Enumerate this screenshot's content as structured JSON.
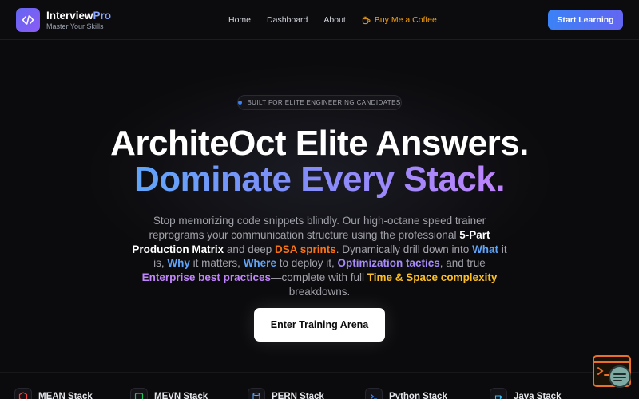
{
  "brand": {
    "name_main": "Interview",
    "name_accent": "Pro",
    "tagline": "Master Your Skills",
    "logo_icon": "code-icon"
  },
  "nav": {
    "links": [
      "Home",
      "Dashboard",
      "About"
    ],
    "coffee_label": "Buy Me a Coffee",
    "coffee_icon": "coffee-cup-icon",
    "cta_label": "Start Learning"
  },
  "hero": {
    "badge": "BUILT FOR ELITE ENGINEERING CANDIDATES",
    "title_line1": "ArchiteOct Elite Answers.",
    "title_line2": "Dominate Every Stack.",
    "desc": {
      "p1": "Stop memorizing code snippets blindly. Our high-octane speed trainer reprograms your communication structure using the professional ",
      "h1": "5-Part Production Matrix",
      "p2": " and deep ",
      "h2": "DSA sprints",
      "p3": ". Dynamically drill down into ",
      "h3": "What",
      "p4": " it is, ",
      "h4": "Why",
      "p5": " it matters, ",
      "h5": "Where",
      "p6": " to deploy it, ",
      "h6": "Optimization tactics",
      "p7": ", and true ",
      "h7": "Enterprise best practices",
      "p8": "—complete with full ",
      "h8": "Time & Space complexity",
      "p9": " breakdowns."
    },
    "enter_label": "Enter Training Arena"
  },
  "stacks": [
    {
      "label": "MEAN Stack",
      "icon": "mean-stack-icon"
    },
    {
      "label": "MEVN Stack",
      "icon": "mevn-stack-icon"
    },
    {
      "label": "PERN Stack",
      "icon": "database-icon"
    },
    {
      "label": "Python Stack",
      "icon": "terminal-icon"
    },
    {
      "label": "Java Stack",
      "icon": "java-cup-icon"
    }
  ],
  "colors": {
    "background": "#0b0b0d",
    "accent_blue": "#3b82f6",
    "accent_indigo": "#6366f1",
    "accent_purple": "#c084fc",
    "accent_orange": "#f97316",
    "accent_amber": "#fbbf24",
    "coffee": "#f59e0b"
  }
}
